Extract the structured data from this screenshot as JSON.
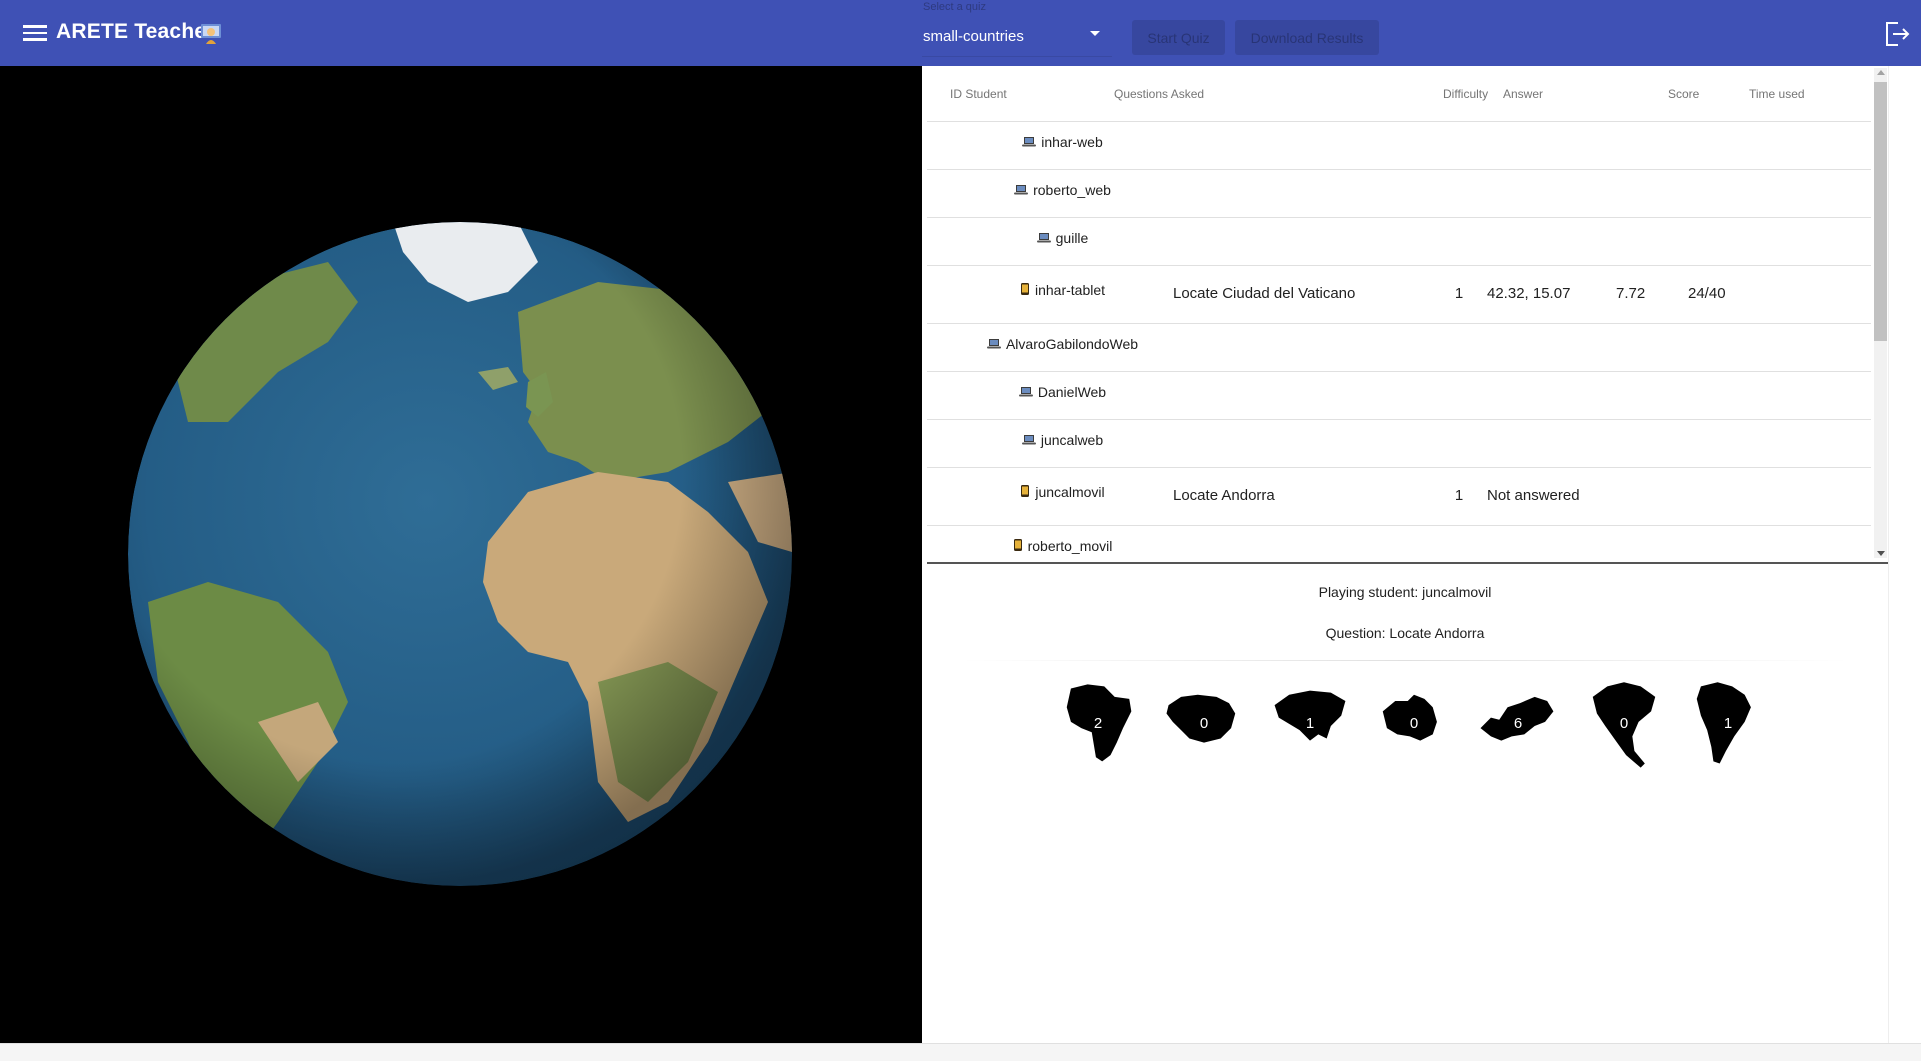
{
  "app": {
    "title": "ARETE Teacher",
    "title_emoji": "teacher-emoji"
  },
  "toolbar": {
    "quiz_select": {
      "caption": "Select a quiz",
      "value": "small-countries"
    },
    "start_label": "Start Quiz",
    "download_label": "Download Results"
  },
  "table": {
    "headers": {
      "id": "ID Student",
      "questions": "Questions Asked",
      "difficulty": "Difficulty",
      "answer": "Answer",
      "score": "Score",
      "time": "Time used"
    },
    "rows": [
      {
        "device": "laptop-icon",
        "id": "inhar-web",
        "question": "",
        "difficulty": "",
        "answer": "",
        "score": "",
        "time": ""
      },
      {
        "device": "laptop-icon",
        "id": "roberto_web",
        "question": "",
        "difficulty": "",
        "answer": "",
        "score": "",
        "time": ""
      },
      {
        "device": "laptop-icon",
        "id": "guille",
        "question": "",
        "difficulty": "",
        "answer": "",
        "score": "",
        "time": ""
      },
      {
        "device": "mobile-icon",
        "id": "inhar-tablet",
        "question": "Locate Ciudad del Vaticano",
        "difficulty": "1",
        "answer": "42.32, 15.07",
        "score": "7.72",
        "time": "24/40"
      },
      {
        "device": "laptop-icon",
        "id": "AlvaroGabilondoWeb",
        "question": "",
        "difficulty": "",
        "answer": "",
        "score": "",
        "time": ""
      },
      {
        "device": "laptop-icon",
        "id": "DanielWeb",
        "question": "",
        "difficulty": "",
        "answer": "",
        "score": "",
        "time": ""
      },
      {
        "device": "laptop-icon",
        "id": "juncalweb",
        "question": "",
        "difficulty": "",
        "answer": "",
        "score": "",
        "time": ""
      },
      {
        "device": "mobile-icon",
        "id": "juncalmovil",
        "question": "Locate Andorra",
        "difficulty": "1",
        "answer": "Not answered",
        "score": "",
        "time": ""
      },
      {
        "device": "mobile-icon",
        "id": "roberto_movil",
        "question": "",
        "difficulty": "",
        "answer": "",
        "score": "",
        "time": ""
      }
    ]
  },
  "details": {
    "playing": "Playing student: juncalmovil",
    "question": "Question: Locate Andorra"
  },
  "continents": [
    {
      "name": "africa",
      "count": "2"
    },
    {
      "name": "antarctica",
      "count": "0"
    },
    {
      "name": "asia",
      "count": "1"
    },
    {
      "name": "oceania",
      "count": "0"
    },
    {
      "name": "europe",
      "count": "6"
    },
    {
      "name": "north-america",
      "count": "0"
    },
    {
      "name": "south-america",
      "count": "1"
    }
  ],
  "colors": {
    "appbar": "#3f51b5",
    "globe_bg": "#000000",
    "ocean": "#2f6d96"
  }
}
